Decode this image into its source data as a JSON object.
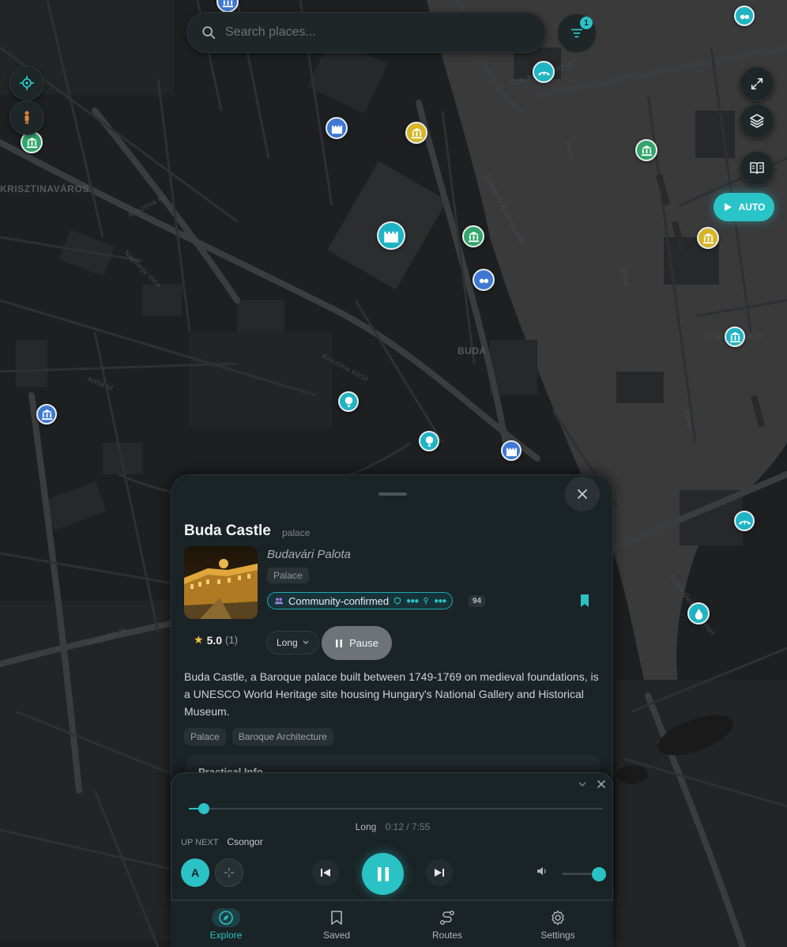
{
  "search": {
    "placeholder": "Search places..."
  },
  "filter": {
    "badge": "1"
  },
  "map": {
    "labels": {
      "krisztinavaros": "KRISZTINAVÁROS",
      "buda": "BUDA",
      "legenda": "LEGENDA HAJÓ"
    },
    "streets": [
      "Attila út",
      "Krisztina tér",
      "Krisztina körút",
      "Naphegy utca",
      "Hegyalja út",
      "Duna",
      "Széchenyi lánchíd",
      "Friedrich Born rakpart",
      "Szent Gellért rakpart"
    ]
  },
  "controls": {
    "auto_label": "AUTO"
  },
  "place": {
    "title": "Buda Castle",
    "type": "palace",
    "original_name": "Budavári Palota",
    "category_chip": "Palace",
    "community_label": "Community-confirmed",
    "community_count": "94",
    "rating": "5.0",
    "rating_count": "(1)",
    "length_option": "Long",
    "pause_label": "Pause",
    "description": "Buda Castle, a Baroque palace built between 1749-1769 on medieval foundations, is a UNESCO World Heritage site housing Hungary's National Gallery and Historical Museum.",
    "tags": [
      "Palace",
      "Baroque Architecture"
    ],
    "practical_info": "Practical Info"
  },
  "player": {
    "length": "Long",
    "time": "0:12 / 7:55",
    "progress": 0.025,
    "up_next_label": "UP NEXT",
    "up_next_name": "Csongor",
    "avatar_letter": "A",
    "volume": 0.9
  },
  "nav": [
    {
      "label": "Explore",
      "icon": "compass-icon",
      "active": true
    },
    {
      "label": "Saved",
      "icon": "bookmark-icon",
      "active": false
    },
    {
      "label": "Routes",
      "icon": "route-icon",
      "active": false
    },
    {
      "label": "Settings",
      "icon": "gear-icon",
      "active": false
    }
  ],
  "colors": {
    "accent": "#2bc2c5",
    "marker_green": "#33a66a",
    "marker_blue": "#3e78d3",
    "marker_yellow": "#d7b524",
    "marker_teal": "#1fb4c4"
  }
}
